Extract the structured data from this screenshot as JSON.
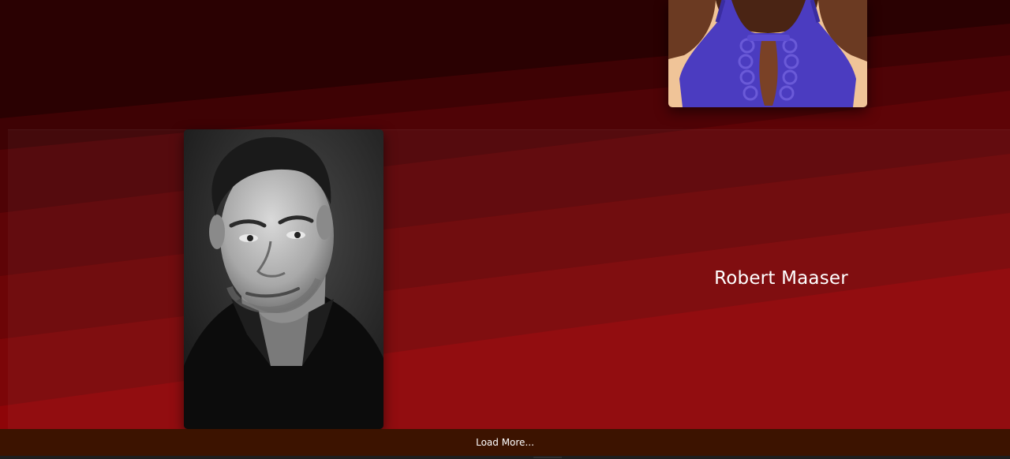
{
  "gallery": {
    "items": [
      {
        "name": "",
        "photo": "performer-headshot-blue-top"
      },
      {
        "name": "Robert Maaser",
        "photo": "performer-headshot-bw"
      }
    ]
  },
  "load_more": {
    "label": "Load More..."
  },
  "colors": {
    "background_dark": "#2a0102",
    "background_red": "#8e0508",
    "load_more_bar": "#3c1300",
    "text": "#ffffff"
  }
}
